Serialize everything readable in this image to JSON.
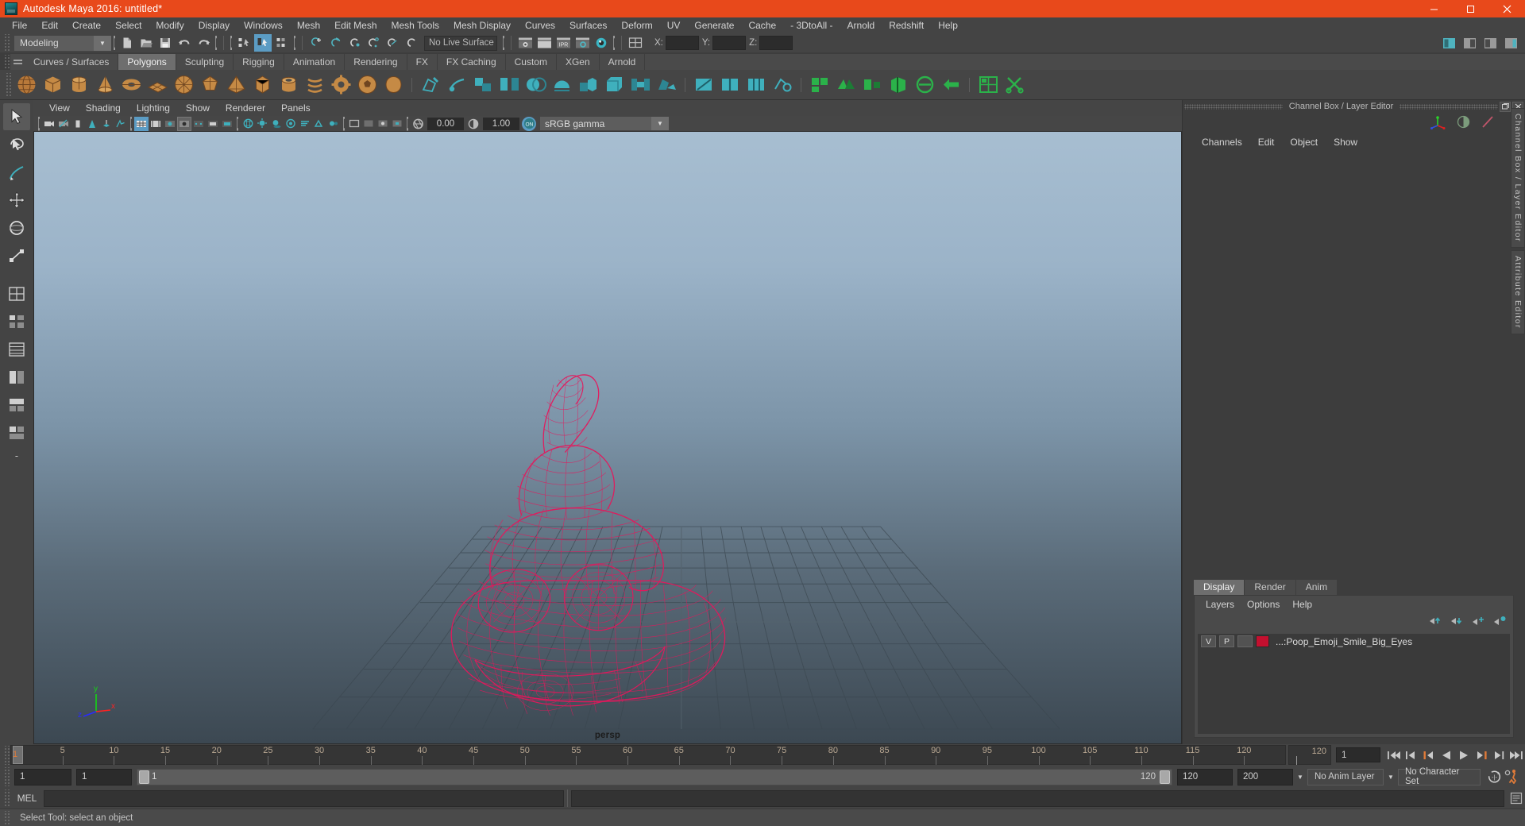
{
  "titlebar": {
    "title": "Autodesk Maya 2016: untitled*",
    "logo_icon": "maya-logo-icon",
    "minimize_icon": "minimize-icon",
    "maximize_icon": "maximize-icon",
    "close_icon": "close-icon"
  },
  "menubar": {
    "items": [
      "File",
      "Edit",
      "Create",
      "Select",
      "Modify",
      "Display",
      "Windows",
      "Mesh",
      "Edit Mesh",
      "Mesh Tools",
      "Mesh Display",
      "Curves",
      "Surfaces",
      "Deform",
      "UV",
      "Generate",
      "Cache",
      "- 3DtoAll -",
      "Arnold",
      "Redshift",
      "Help"
    ]
  },
  "statusline": {
    "menuset": "Modeling",
    "menuset_arrow_icon": "chevron-down-icon",
    "live_surface": "No Live Surface",
    "coord_labels": [
      "X:",
      "Y:",
      "Z:"
    ],
    "coord_values": [
      "",
      "",
      ""
    ],
    "icons": [
      "new-scene-icon",
      "open-scene-icon",
      "save-scene-icon",
      "undo-icon",
      "redo-icon",
      "select-by-hierarchy-icon",
      "select-by-object-icon",
      "select-by-component-icon",
      "snap-to-grid-icon",
      "snap-to-curve-icon",
      "snap-to-point-icon",
      "snap-to-projected-center-icon",
      "snap-to-view-plane-icon",
      "make-live-icon",
      "render-view-icon",
      "render-current-frame-icon",
      "ipr-render-icon",
      "render-settings-icon",
      "hypershade-icon",
      "editor-layout-icon"
    ],
    "right_icons": [
      "show-hide-modeling-toolkit-icon",
      "show-hide-attribute-editor-icon",
      "show-hide-tool-settings-icon",
      "show-hide-channel-box-icon"
    ]
  },
  "shelf": {
    "tabs": [
      "Curves / Surfaces",
      "Polygons",
      "Sculpting",
      "Rigging",
      "Animation",
      "Rendering",
      "FX",
      "FX Caching",
      "Custom",
      "XGen",
      "Arnold"
    ],
    "active_tab": "Polygons",
    "icons": [
      "poly-sphere-icon",
      "poly-cube-icon",
      "poly-cylinder-icon",
      "poly-cone-icon",
      "poly-torus-icon",
      "poly-plane-icon",
      "poly-disc-icon",
      "poly-platonic-icon",
      "poly-pyramid-icon",
      "poly-prism-icon",
      "poly-pipe-icon",
      "poly-helix-icon",
      "poly-gear-icon",
      "poly-soccer-ball-icon",
      "poly-super-ellipse-icon",
      "create-polygon-tool-icon",
      "sculpt-geometry-icon",
      "combine-icon",
      "separate-icon",
      "booleans-icon",
      "smooth-icon",
      "extrude-icon",
      "bevel-icon",
      "bridge-icon",
      "append-polygon-icon",
      "multi-cut-icon",
      "insert-edge-loop-icon",
      "offset-edge-loop-icon",
      "target-weld-icon",
      "quad-draw-icon",
      "mirror-icon",
      "reduce-icon"
    ]
  },
  "toolbox": {
    "items": [
      {
        "name": "select-tool",
        "icon": "arrow-cursor-icon",
        "active": true
      },
      {
        "name": "lasso-tool",
        "icon": "lasso-icon",
        "active": false
      },
      {
        "name": "paint-select-tool",
        "icon": "paint-brush-icon",
        "active": false
      },
      {
        "name": "move-tool",
        "icon": "move-arrows-icon",
        "active": false
      },
      {
        "name": "rotate-tool",
        "icon": "rotate-circle-icon",
        "active": false
      },
      {
        "name": "scale-tool",
        "icon": "scale-box-icon",
        "active": false
      },
      {
        "name": "last-tool",
        "icon": "last-tool-icon",
        "active": false
      }
    ],
    "layouts": [
      {
        "name": "single-perspective-layout",
        "icon": "single-pane-icon"
      },
      {
        "name": "four-view-layout",
        "icon": "four-pane-icon"
      },
      {
        "name": "persp-outliner-layout",
        "icon": "two-pane-vertical-icon"
      },
      {
        "name": "persp-graph-layout",
        "icon": "two-pane-horizontal-icon"
      },
      {
        "name": "hypershade-render-layout",
        "icon": "three-pane-icon"
      },
      {
        "name": "persp-uv-layout",
        "icon": "split-pane-icon"
      }
    ],
    "more_label": "-"
  },
  "viewport": {
    "menus": [
      "View",
      "Shading",
      "Lighting",
      "Show",
      "Renderer",
      "Panels"
    ],
    "toolbar_icons": [
      "select-camera-icon",
      "lock-camera-icon",
      "camera-attributes-icon",
      "bookmark-icon",
      "image-plane-icon",
      "two-d-pan-zoom-icon",
      "grid-toggle-icon",
      "film-gate-icon",
      "resolution-gate-icon",
      "gate-mask-icon",
      "wireframe-icon",
      "smooth-shade-all-icon",
      "shaded-wireframe-icon",
      "textured-icon",
      "use-all-lights-icon",
      "shadows-icon",
      "screen-space-ao-icon",
      "motion-blur-icon",
      "multisample-aa-icon",
      "depth-of-field-icon",
      "isolate-select-icon",
      "xray-icon",
      "xray-joints-icon",
      "xray-active-components-icon",
      "exposure-icon",
      "gamma-icon",
      "color-management-toggle-icon"
    ],
    "exposure_value": "0.00",
    "gamma_value": "1.00",
    "color_profile": "sRGB gamma",
    "color_profile_arrow_icon": "chevron-down-icon",
    "panel_label": "persp",
    "axis_labels": {
      "x": "x",
      "y": "y",
      "z": "z"
    },
    "object_wire_color": "#e5175c"
  },
  "channelbox": {
    "panel_title": "Channel Box / Layer Editor",
    "restore_icon": "restore-window-icon",
    "close_icon": "close-window-icon",
    "header_icons": [
      "move-manip-axis-icon",
      "shading-sphere-icon",
      "edit-attribute-icon"
    ],
    "menus": [
      "Channels",
      "Edit",
      "Object",
      "Show"
    ],
    "side_tabs": [
      "Channel Box / Layer Editor",
      "Attribute Editor"
    ]
  },
  "layer_editor": {
    "tabs": [
      "Display",
      "Render",
      "Anim"
    ],
    "active_tab": "Display",
    "menus": [
      "Layers",
      "Options",
      "Help"
    ],
    "buttons": [
      "move-layer-up-icon",
      "move-layer-down-icon",
      "new-layer-icon",
      "new-layer-from-selected-icon"
    ],
    "layers": [
      {
        "visibility": "V",
        "playback": "P",
        "shading": "",
        "color": "#c4102f",
        "name": "...:Poop_Emoji_Smile_Big_Eyes"
      }
    ]
  },
  "timeslider": {
    "ticks": [
      {
        "label": "5",
        "frame": 5
      },
      {
        "label": "10",
        "frame": 10
      },
      {
        "label": "15",
        "frame": 15
      },
      {
        "label": "20",
        "frame": 20
      },
      {
        "label": "25",
        "frame": 25
      },
      {
        "label": "30",
        "frame": 30
      },
      {
        "label": "35",
        "frame": 35
      },
      {
        "label": "40",
        "frame": 40
      },
      {
        "label": "45",
        "frame": 45
      },
      {
        "label": "50",
        "frame": 50
      },
      {
        "label": "55",
        "frame": 55
      },
      {
        "label": "60",
        "frame": 60
      },
      {
        "label": "65",
        "frame": 65
      },
      {
        "label": "70",
        "frame": 70
      },
      {
        "label": "75",
        "frame": 75
      },
      {
        "label": "80",
        "frame": 80
      },
      {
        "label": "85",
        "frame": 85
      },
      {
        "label": "90",
        "frame": 90
      },
      {
        "label": "95",
        "frame": 95
      },
      {
        "label": "100",
        "frame": 100
      },
      {
        "label": "105",
        "frame": 105
      },
      {
        "label": "110",
        "frame": 110
      },
      {
        "label": "115",
        "frame": 115
      },
      {
        "label": "120",
        "frame": 120
      }
    ],
    "current_frame": "1",
    "end_frame_label": "120",
    "frame_field_value": "1",
    "playback_buttons": [
      "go-to-start-icon",
      "step-back-keyframe-icon",
      "step-back-frame-icon",
      "play-backwards-icon",
      "play-forwards-icon",
      "step-forward-frame-icon",
      "step-forward-keyframe-icon",
      "go-to-end-icon"
    ]
  },
  "rangeslider": {
    "anim_start": "1",
    "range_start": "1",
    "bar_start_label": "1",
    "bar_end_label": "120",
    "range_end": "120",
    "anim_end": "200",
    "anim_layer": "No Anim Layer",
    "character_set": "No Character Set",
    "anim_layer_arrow_icon": "chevron-down-icon",
    "character_set_arrow_icon": "chevron-down-icon",
    "auto_key_icon": "auto-keyframe-icon",
    "anim_prefs_icon": "animation-preferences-icon"
  },
  "command_line": {
    "language_label": "MEL",
    "input_value": "",
    "input_placeholder": "",
    "output_value": "",
    "script-editor_icon": "script-editor-icon"
  },
  "status_bar": {
    "message": "Select Tool: select an object",
    "progress_icon": "progress-bar-icon"
  },
  "colors": {
    "accent_orange": "#e8491b",
    "panel_bg": "#3d3d3d",
    "widget_bg": "#444444",
    "highlight_blue": "#5b9cc4",
    "wire_pink": "#e5175c",
    "layer_swatch": "#c4102f"
  }
}
